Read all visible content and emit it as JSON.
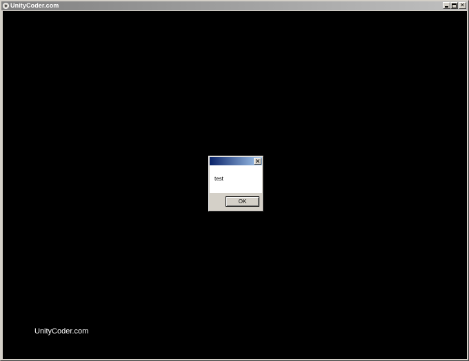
{
  "window": {
    "title": "UnityCoder.com",
    "app_icon": "unity-icon",
    "controls": {
      "minimize_icon": "minimize-icon",
      "maximize_icon": "maximize-icon",
      "close_glyph": "✕"
    }
  },
  "canvas": {
    "background": "#000000",
    "watermark": "UnityCoder.com"
  },
  "message_box": {
    "title": "",
    "close_glyph": "✕",
    "message": "test",
    "ok_label": "OK",
    "title_gradient": [
      "#0a246a",
      "#a6caf0"
    ]
  }
}
